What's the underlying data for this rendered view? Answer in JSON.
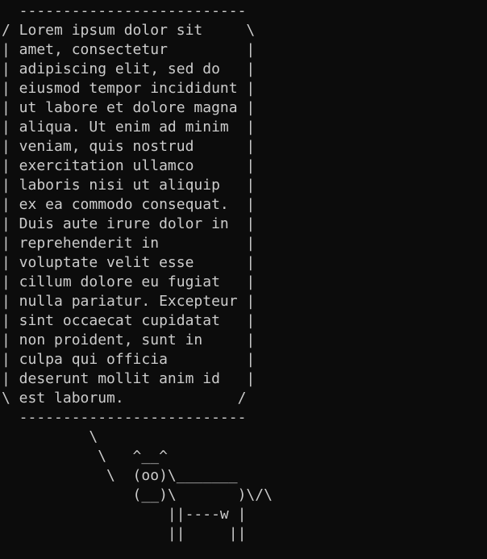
{
  "colors": {
    "background": "#0c0c0c",
    "text": "#cccccc"
  },
  "terminal": {
    "lines": [
      "  --------------------------",
      "/ Lorem ipsum dolor sit     \\",
      "| amet, consectetur         |",
      "| adipiscing elit, sed do   |",
      "| eiusmod tempor incididunt |",
      "| ut labore et dolore magna |",
      "| aliqua. Ut enim ad minim  |",
      "| veniam, quis nostrud      |",
      "| exercitation ullamco      |",
      "| laboris nisi ut aliquip   |",
      "| ex ea commodo consequat.  |",
      "| Duis aute irure dolor in  |",
      "| reprehenderit in          |",
      "| voluptate velit esse      |",
      "| cillum dolore eu fugiat   |",
      "| nulla pariatur. Excepteur |",
      "| sint occaecat cupidatat   |",
      "| non proident, sunt in     |",
      "| culpa qui officia         |",
      "| deserunt mollit anim id   |",
      "\\ est laborum.             /",
      "  --------------------------",
      "          \\",
      "           \\   ^__^",
      "            \\  (oo)\\_______",
      "               (__)\\       )\\/\\",
      "                   ||----w |",
      "                   ||     ||"
    ]
  }
}
